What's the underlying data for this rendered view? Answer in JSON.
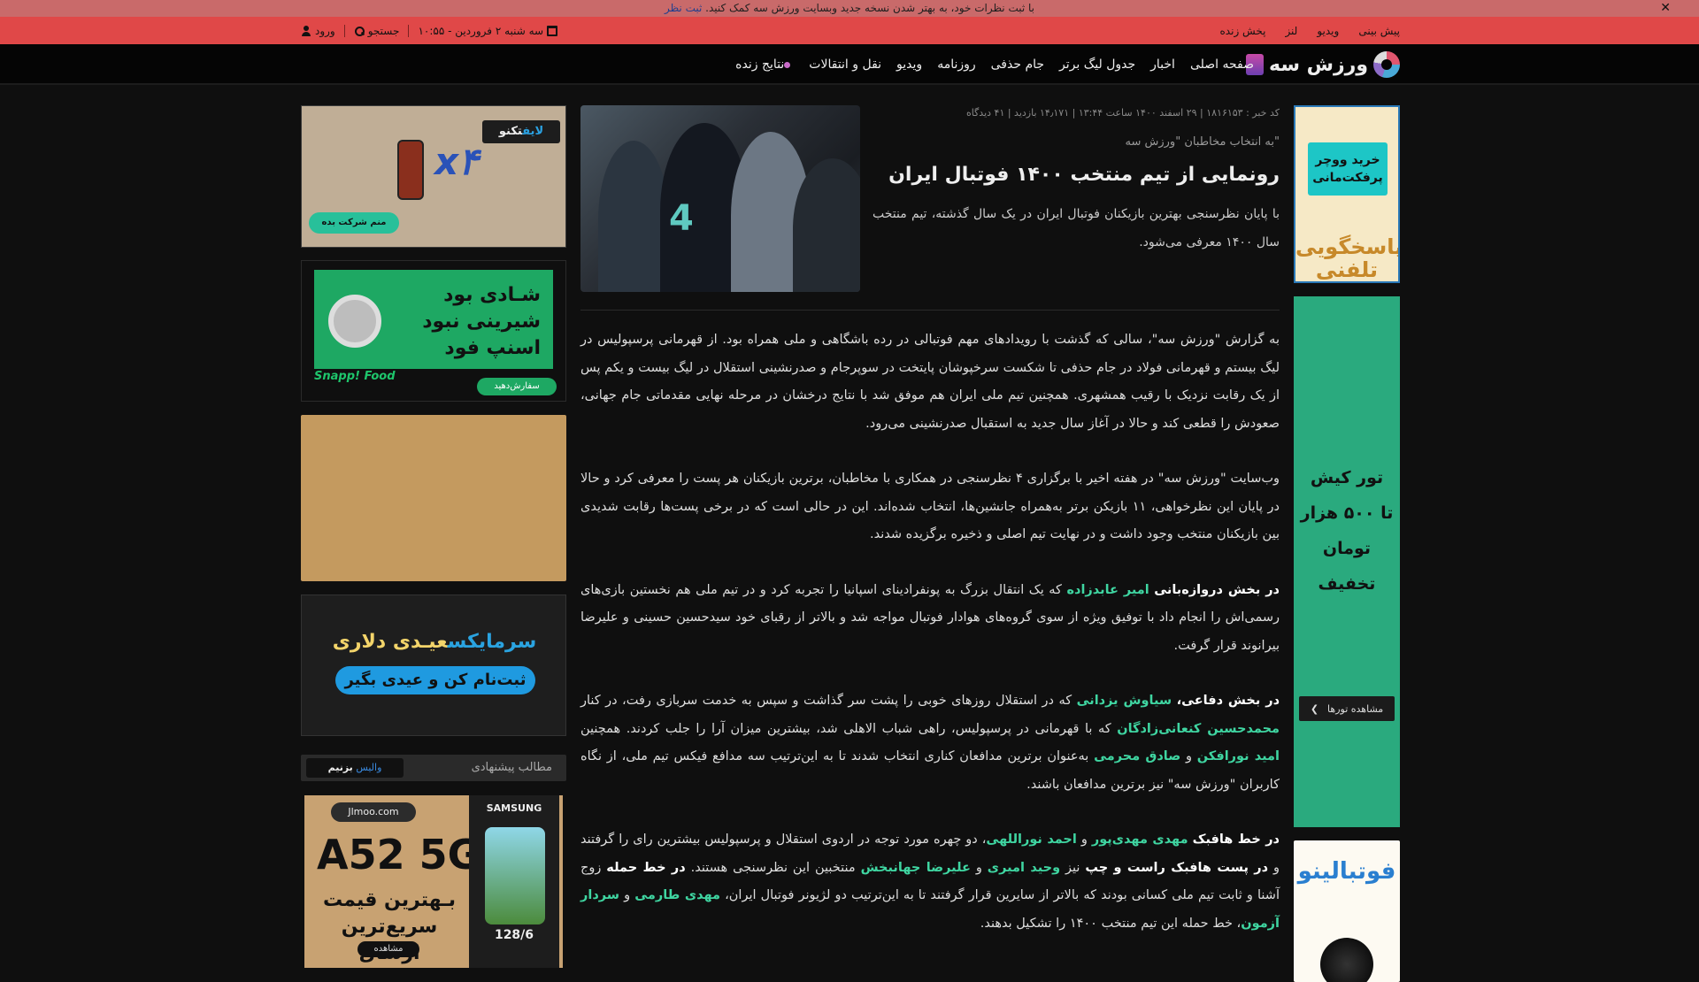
{
  "notice": {
    "text": "با ثبت نظرات خود، به بهتر شدن نسخه جدید وبسایت ورزش سه کمک کنید.",
    "cta": "ثبت نظر",
    "close": "✕"
  },
  "topbar": {
    "links": [
      "پیش بینی",
      "ویدیو",
      "لنز",
      "پخش زنده"
    ],
    "date": "سه شنبه ۲ فروردین - ۱۰:۵۵",
    "search": "جستجو",
    "login": "ورود"
  },
  "nav": {
    "logo_text": "ورزش سه",
    "items": [
      "صفحه اصلی",
      "اخبار",
      "جدول لیگ برتر",
      "جام حذفی",
      "روزنامه",
      "ویدیو",
      "نقل و انتقالات",
      "نتایج زنده"
    ]
  },
  "article": {
    "meta": "کد خبر : ۱۸۱۶۱۵۳ | ۲۹ اسفند ۱۴۰۰ ساعت ۱۳:۴۴ | ۱۴٫۱۷۱ بازدید | ۴۱ دیدگاه",
    "kicker": "به انتخاب مخاطبان \"ورزش سه\"",
    "title": "رونمایی از تیم منتخب ۱۴۰۰ فوتبال ایران",
    "lead": "با پایان نظرسنجی بهترین بازیکنان فوتبال ایران در یک سال گذشته، تیم منتخب سال ۱۴۰۰ معرفی می‌شود.",
    "hero_number": "4",
    "p1": "به گزارش \"ورزش سه\"، سالی که گذشت با رویدادهای مهم فوتبالی در رده باشگاهی و ملی همراه بود. از قهرمانی پرسپولیس در لیگ بیستم و قهرمانی فولاد در جام حذفی تا شکست سرخپوشان پایتخت در سوپرجام و صدرنشینی استقلال در لیگ بیست و یکم پس از یک رقابت نزدیک با رقیب همشهری. همچنین تیم ملی ایران هم موفق شد با نتایج درخشان در مرحله نهایی مقدماتی جام جهانی، صعودش را قطعی کند و حالا در آغاز سال جدید به استقبال صدرنشینی می‌رود.",
    "p2": "وب‌سایت \"ورزش سه\" در هفته اخیر با برگزاری ۴ نظرسنجی در همکاری با مخاطبان، برترین بازیکنان هر پست را معرفی کرد و حالا در پایان این نظرخواهی، ۱۱ بازیکن برتر به‌همراه جانشین‌ها، انتخاب شده‌اند. این در حالی است که در برخی پست‌ها رقابت شدیدی بین بازیکنان منتخب وجود داشت و در نهایت تیم اصلی و ذخیره برگزیده شدند.",
    "p3": {
      "b1": "در بخش دروازه‌بانی",
      "n1": "امیر عابدزاده",
      "t1": " که یک انتقال بزرگ به پونفرادینای اسپانیا را تجربه کرد و در تیم ملی هم نخستین بازی‌های رسمی‌اش را انجام داد با توفیق ویژه از سوی گروه‌های هوادار فوتبال مواجه شد و بالاتر از رقبای خود سیدحسین حسینی و علیرضا بیرانوند قرار گرفت."
    },
    "p4": {
      "b1": "در بخش دفاعی،",
      "n1": "سیاوش یزدانی",
      "t1": " که در استقلال روزهای خوبی را پشت سر گذاشت و سپس به خدمت سربازی رفت، در کنار ",
      "n2": "محمدحسین کنعانی‌زادگان",
      "t2": " که با قهرمانی در پرسپولیس، راهی شباب الاهلی شد، بیشترین میزان آرا را جلب کردند. همچنین ",
      "n3": "امید نورافکن",
      "t3": " و ",
      "n4": "صادق محرمی",
      "t4": " به‌عنوان برترین مدافعان کناری انتخاب شدند تا به این‌ترتیب سه مدافع فیکس تیم ملی، از نگاه کاربران \"ورزش سه\" نیز برترین مدافعان باشند."
    },
    "p5": {
      "b1": "در خط هافبک",
      "n1": "مهدی مهدی‌پور",
      "t1": " و ",
      "n2": "احمد نوراللهی",
      "t2": "، دو چهره مورد توجه در اردوی استقلال و پرسپولیس بیشترین رای را گرفتند و ",
      "b2": "در پست هافبک راست و چپ",
      "t3": " نیز ",
      "n3": "وحید امیری",
      "t4": " و ",
      "n4": "علیرضا جهانبخش",
      "t5": " منتخبین این نظرسنجی هستند. ",
      "b3": "در خط حمله",
      "t6": " زوج آشنا و ثابت تیم ملی کسانی بودند که بالاتر از سایرین قرار گرفتند تا به این‌ترتیب دو لژیونر فوتبال ایران، ",
      "n5": "مهدی طارمی",
      "t7": " و ",
      "n6": "سردار آزمون",
      "t8": "، خط حمله این تیم منتخب ۱۴۰۰ را تشکیل بدهند."
    }
  },
  "ads_right": {
    "a1_box": "خرید ووچر پرفکت‌مانی",
    "a1_text": "پاسخگویی تلفنی",
    "a2_line1": "تور کیش",
    "a2_line2": "تا ۵۰۰ هزار تومان",
    "a2_line3": "تخفیف",
    "a2_btn": "مشاهده تورها",
    "a3_text": "فوتبالینو"
  },
  "ads_left": {
    "a1_brand_a": "تکنو",
    "a1_brand_b": "لایف",
    "a1_big": "x۴",
    "a1_cta": "منم شرکت بده",
    "a2_l1": "شـادی بود",
    "a2_l2": "شیرینی نبود",
    "a2_l3": "اسنپ فود",
    "a2_logo": "Snapp! Food",
    "a2_btn": "سفارش‌دهید",
    "a4_t1a": "عیـدی دلاری ",
    "a4_t1b": "سرمایکس",
    "a4_pill": "ثبت‌نام کن و عیدی بگیر",
    "sugg_label": "مطالب پیشنهادی",
    "sugg_tag_a": "والیس ",
    "sugg_tag_b": "بزنیم",
    "a5_brand": "Jlmoo.com",
    "a5_model": "A52 5G",
    "a5_price": "بـهترین قیمت سریع‌ترین ارسال",
    "a5_more": "مشاهده",
    "a5_phone_brand": "SAMSUNG",
    "a5_spec": "128/6"
  }
}
